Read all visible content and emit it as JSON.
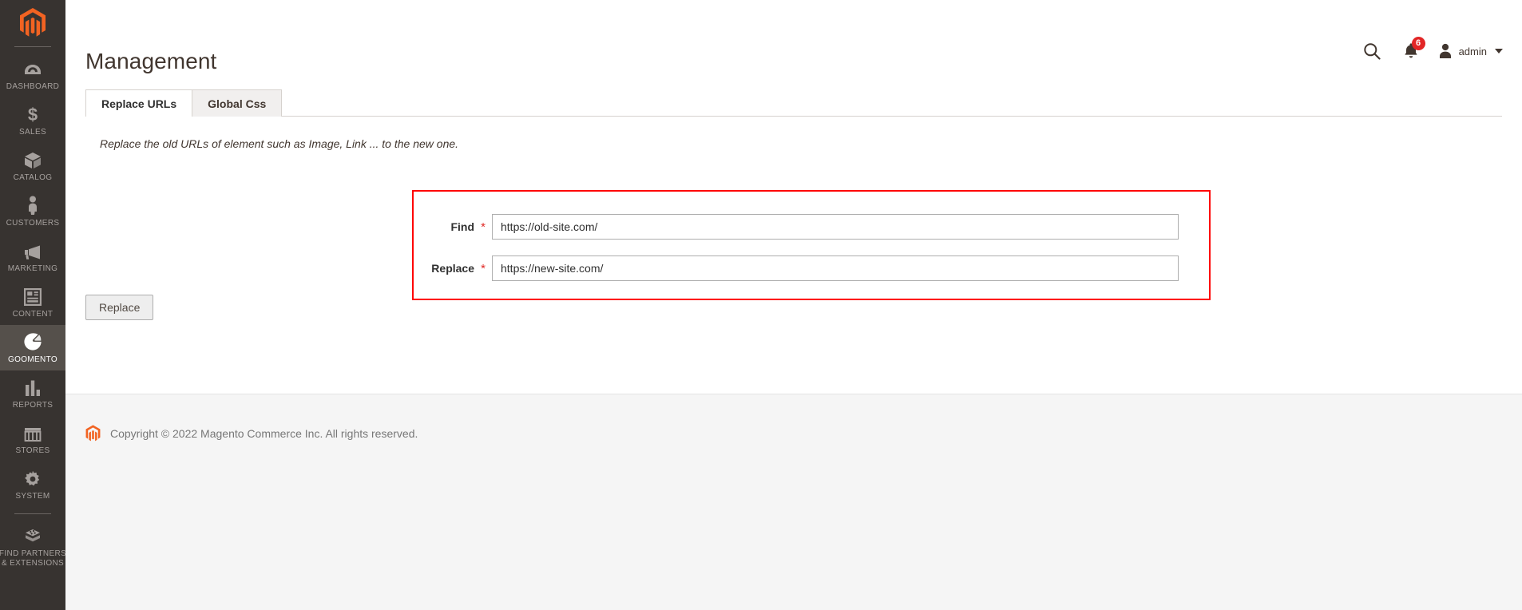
{
  "sidebar": {
    "logo_icon": "magento-logo-icon",
    "items": [
      {
        "label": "Dashboard",
        "icon": "dashboard-icon",
        "active": false
      },
      {
        "label": "Sales",
        "icon": "dollar-icon",
        "active": false
      },
      {
        "label": "Catalog",
        "icon": "box-icon",
        "active": false
      },
      {
        "label": "Customers",
        "icon": "person-icon",
        "active": false
      },
      {
        "label": "Marketing",
        "icon": "megaphone-icon",
        "active": false
      },
      {
        "label": "Content",
        "icon": "layout-icon",
        "active": false
      },
      {
        "label": "Goomento",
        "icon": "goomento-icon",
        "active": true
      },
      {
        "label": "Reports",
        "icon": "bar-chart-icon",
        "active": false
      },
      {
        "label": "Stores",
        "icon": "storefront-icon",
        "active": false
      },
      {
        "label": "System",
        "icon": "gear-icon",
        "active": false
      }
    ],
    "partners": {
      "label": "Find Partners\n& Extensions",
      "line1": "Find Partners",
      "line2": "& Extensions",
      "icon": "extension-blocks-icon"
    }
  },
  "header": {
    "title": "Management",
    "search_icon": "search-icon",
    "notifications": {
      "icon": "bell-icon",
      "count": "6"
    },
    "admin": {
      "avatar_icon": "user-avatar-icon",
      "name": "admin",
      "caret_icon": "chevron-down-icon"
    }
  },
  "tabs": [
    {
      "label": "Replace URLs",
      "active": true
    },
    {
      "label": "Global Css",
      "active": false
    }
  ],
  "content": {
    "intro": "Replace the old URLs of element such as Image, Link ... to the new one.",
    "fields": [
      {
        "label": "Find",
        "required": "*",
        "value": "https://old-site.com/",
        "placeholder": ""
      },
      {
        "label": "Replace",
        "required": "*",
        "value": "https://new-site.com/",
        "placeholder": ""
      }
    ],
    "submit_label": "Replace",
    "highlight_color": "#ff0000"
  },
  "footer": {
    "logo_icon": "magento-logo-icon",
    "copyright": "Copyright © 2022 Magento Commerce Inc. All rights reserved."
  }
}
